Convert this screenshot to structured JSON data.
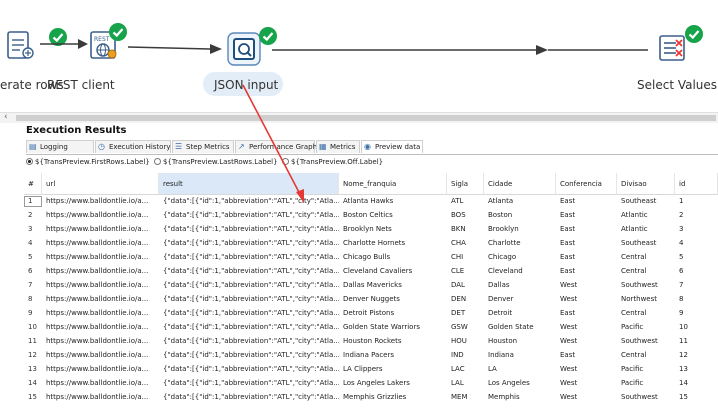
{
  "canvas": {
    "steps": [
      {
        "id": "generate-rows",
        "label": "erate rows"
      },
      {
        "id": "rest-client",
        "label": "REST client"
      },
      {
        "id": "json-input",
        "label": "JSON input"
      },
      {
        "id": "select-values",
        "label": "Select Values"
      }
    ]
  },
  "results": {
    "title": "Execution Results",
    "tabs": [
      "Logging",
      "Execution History",
      "Step Metrics",
      "Performance Graph",
      "Metrics",
      "Preview data"
    ],
    "active_tab": "Preview data",
    "radios": [
      "${TransPreview.FirstRows.Label}",
      "${TransPreview.LastRows.Label}",
      "${TransPreview.Off.Label}"
    ],
    "selected_radio": "${TransPreview.FirstRows.Label}",
    "columns": [
      "#",
      "url",
      "result",
      "Nome_franquia",
      "Sigla",
      "Cidade",
      "Conferencia",
      "Divisao",
      "id"
    ],
    "rows": [
      [
        "1",
        "https://www.balldontlie.io/a...",
        "{\"data\":[{\"id\":1,\"abbreviation\":\"ATL\",\"city\":\"Atla...",
        "Atlanta Hawks",
        "ATL",
        "Atlanta",
        "East",
        "Southeast",
        "1"
      ],
      [
        "2",
        "https://www.balldontlie.io/a...",
        "{\"data\":[{\"id\":1,\"abbreviation\":\"ATL\",\"city\":\"Atla...",
        "Boston Celtics",
        "BOS",
        "Boston",
        "East",
        "Atlantic",
        "2"
      ],
      [
        "3",
        "https://www.balldontlie.io/a...",
        "{\"data\":[{\"id\":1,\"abbreviation\":\"ATL\",\"city\":\"Atla...",
        "Brooklyn Nets",
        "BKN",
        "Brooklyn",
        "East",
        "Atlantic",
        "3"
      ],
      [
        "4",
        "https://www.balldontlie.io/a...",
        "{\"data\":[{\"id\":1,\"abbreviation\":\"ATL\",\"city\":\"Atla...",
        "Charlotte Hornets",
        "CHA",
        "Charlotte",
        "East",
        "Southeast",
        "4"
      ],
      [
        "5",
        "https://www.balldontlie.io/a...",
        "{\"data\":[{\"id\":1,\"abbreviation\":\"ATL\",\"city\":\"Atla...",
        "Chicago Bulls",
        "CHI",
        "Chicago",
        "East",
        "Central",
        "5"
      ],
      [
        "6",
        "https://www.balldontlie.io/a...",
        "{\"data\":[{\"id\":1,\"abbreviation\":\"ATL\",\"city\":\"Atla...",
        "Cleveland Cavaliers",
        "CLE",
        "Cleveland",
        "East",
        "Central",
        "6"
      ],
      [
        "7",
        "https://www.balldontlie.io/a...",
        "{\"data\":[{\"id\":1,\"abbreviation\":\"ATL\",\"city\":\"Atla...",
        "Dallas Mavericks",
        "DAL",
        "Dallas",
        "West",
        "Southwest",
        "7"
      ],
      [
        "8",
        "https://www.balldontlie.io/a...",
        "{\"data\":[{\"id\":1,\"abbreviation\":\"ATL\",\"city\":\"Atla...",
        "Denver Nuggets",
        "DEN",
        "Denver",
        "West",
        "Northwest",
        "8"
      ],
      [
        "9",
        "https://www.balldontlie.io/a...",
        "{\"data\":[{\"id\":1,\"abbreviation\":\"ATL\",\"city\":\"Atla...",
        "Detroit Pistons",
        "DET",
        "Detroit",
        "East",
        "Central",
        "9"
      ],
      [
        "10",
        "https://www.balldontlie.io/a...",
        "{\"data\":[{\"id\":1,\"abbreviation\":\"ATL\",\"city\":\"Atla...",
        "Golden State Warriors",
        "GSW",
        "Golden State",
        "West",
        "Pacific",
        "10"
      ],
      [
        "11",
        "https://www.balldontlie.io/a...",
        "{\"data\":[{\"id\":1,\"abbreviation\":\"ATL\",\"city\":\"Atla...",
        "Houston Rockets",
        "HOU",
        "Houston",
        "West",
        "Southwest",
        "11"
      ],
      [
        "12",
        "https://www.balldontlie.io/a...",
        "{\"data\":[{\"id\":1,\"abbreviation\":\"ATL\",\"city\":\"Atla...",
        "Indiana Pacers",
        "IND",
        "Indiana",
        "East",
        "Central",
        "12"
      ],
      [
        "13",
        "https://www.balldontlie.io/a...",
        "{\"data\":[{\"id\":1,\"abbreviation\":\"ATL\",\"city\":\"Atla...",
        "LA Clippers",
        "LAC",
        "LA",
        "West",
        "Pacific",
        "13"
      ],
      [
        "14",
        "https://www.balldontlie.io/a...",
        "{\"data\":[{\"id\":1,\"abbreviation\":\"ATL\",\"city\":\"Atla...",
        "Los Angeles Lakers",
        "LAL",
        "Los Angeles",
        "West",
        "Pacific",
        "14"
      ],
      [
        "15",
        "https://www.balldontlie.io/a...",
        "{\"data\":[{\"id\":1,\"abbreviation\":\"ATL\",\"city\":\"Atla...",
        "Memphis Grizzlies",
        "MEM",
        "Memphis",
        "West",
        "Southwest",
        "15"
      ]
    ]
  },
  "colors": {
    "accent": "#1f6fb5",
    "check": "#16a34a",
    "annotation": "#e53935",
    "hop": "#3b3b3b",
    "selected_header": "#dbe8f7"
  }
}
